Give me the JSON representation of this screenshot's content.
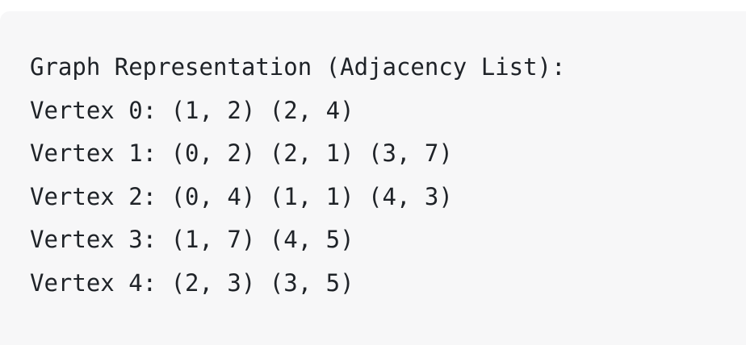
{
  "output": {
    "lines": [
      "Graph Representation (Adjacency List):",
      "Vertex 0: (1, 2) (2, 4)",
      "Vertex 1: (0, 2) (2, 1) (3, 7)",
      "Vertex 2: (0, 4) (1, 1) (4, 3)",
      "Vertex 3: (1, 7) (4, 5)",
      "Vertex 4: (2, 3) (3, 5)"
    ]
  },
  "colors": {
    "background": "#f7f7f8",
    "text": "#1f2328"
  }
}
